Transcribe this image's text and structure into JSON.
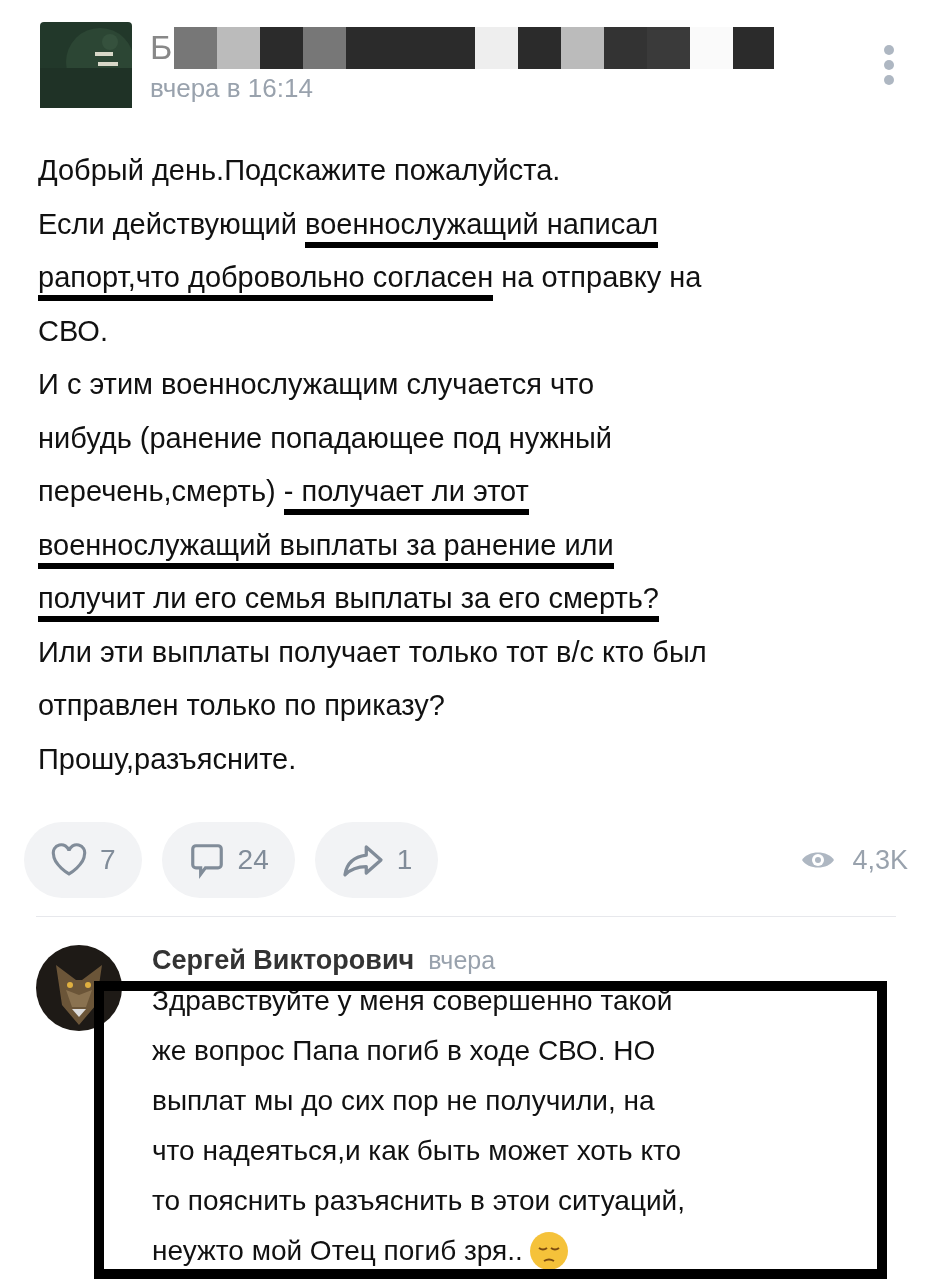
{
  "post": {
    "author_initial": "Б",
    "time": "вчера в 16:14",
    "lines": [
      [
        {
          "text": "Добрый день.Подскажите пожалуйста.",
          "marked": false
        }
      ],
      [
        {
          "text": "Если действующий ",
          "marked": false
        },
        {
          "text": "военнослужащий написал",
          "marked": true
        }
      ],
      [
        {
          "text": "рапорт,что добровольно согласен",
          "marked": true
        },
        {
          "text": " на отправку на",
          "marked": false
        }
      ],
      [
        {
          "text": "СВО.",
          "marked": false
        }
      ],
      [
        {
          "text": "И с этим военнослужащим случается что",
          "marked": false
        }
      ],
      [
        {
          "text": "нибудь (ранение попадающее под нужный",
          "marked": false
        }
      ],
      [
        {
          "text": "перечень,смерть) ",
          "marked": false
        },
        {
          "text": "- получает ли этот",
          "marked": true
        }
      ],
      [
        {
          "text": "военнослужащий выплаты за ранение или",
          "marked": true
        }
      ],
      [
        {
          "text": "получит ли его семья выплаты за его смерть?",
          "marked": true
        }
      ],
      [
        {
          "text": "Или эти выплаты получает только тот в/с кто был",
          "marked": false
        }
      ],
      [
        {
          "text": "отправлен только по приказу?",
          "marked": false
        }
      ],
      [
        {
          "text": "Прошу,разъясните.",
          "marked": false
        }
      ]
    ],
    "actions": [
      {
        "kind": "like",
        "count": "7"
      },
      {
        "kind": "comment",
        "count": "24"
      },
      {
        "kind": "share",
        "count": "1"
      }
    ],
    "views": "4,3K"
  },
  "comment": {
    "author": "Сергей Викторович",
    "time": "вчера",
    "framed": true,
    "lines": [
      "Здравствуйте у меня совершенно такой",
      "же вопрос Папа погиб в ходе СВО. НО",
      "выплат мы до сих пор не получили, на",
      "что надеяться,и как быть может хоть кто",
      "то пояснить разъяснить в этои ситуаций,",
      "неужто мой Отец погиб зря.."
    ]
  }
}
